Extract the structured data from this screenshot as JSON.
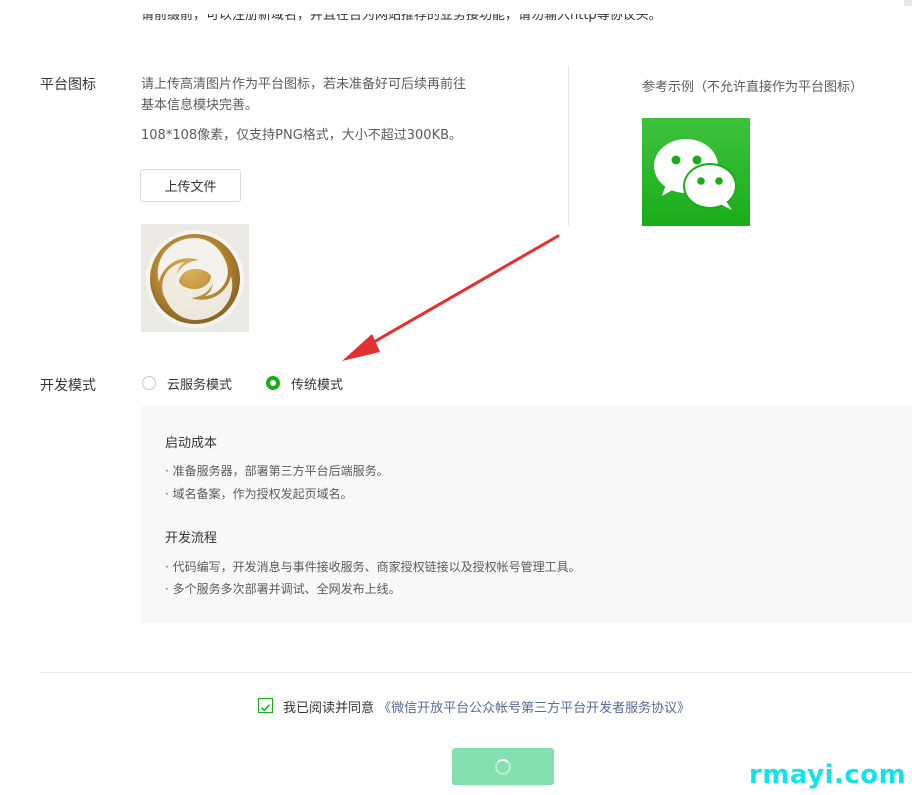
{
  "top_partial_text": "请前缀前，可以注册新域名，并且在台为网站推荐的业务接功能，请勿输入http等协议头。",
  "platform_icon": {
    "label": "平台图标",
    "desc_line1": "请上传高清图片作为平台图标，若未准备好可后续再前往",
    "desc_line2": "基本信息模块完善。",
    "spec": "108*108像素，仅支持PNG格式，大小不超过300KB。",
    "upload_label": "上传文件",
    "ref_label": "参考示例（不允许直接作为平台图标）"
  },
  "dev_mode": {
    "label": "开发模式",
    "options": [
      {
        "label": "云服务模式",
        "selected": false
      },
      {
        "label": "传统模式",
        "selected": true
      }
    ],
    "panel": {
      "sections": [
        {
          "title": "启动成本",
          "items": [
            "准备服务器，部署第三方平台后端服务。",
            "域名备案，作为授权发起页域名。"
          ]
        },
        {
          "title": "开发流程",
          "items": [
            "代码编写，开发消息与事件接收服务、商家授权链接以及授权帐号管理工具。",
            "多个服务多次部署并调试、全网发布上线。"
          ]
        }
      ]
    }
  },
  "agreement": {
    "checked": true,
    "prefix": "我已阅读并同意",
    "link": "《微信开放平台公众帐号第三方平台开发者服务协议》"
  },
  "watermark": "rmayi.com",
  "colors": {
    "accent": "#1aad19",
    "submit_loading": "#84e0b0",
    "link": "#576b95",
    "annotation_arrow": "#e53030",
    "watermark": "#13e3e9"
  }
}
